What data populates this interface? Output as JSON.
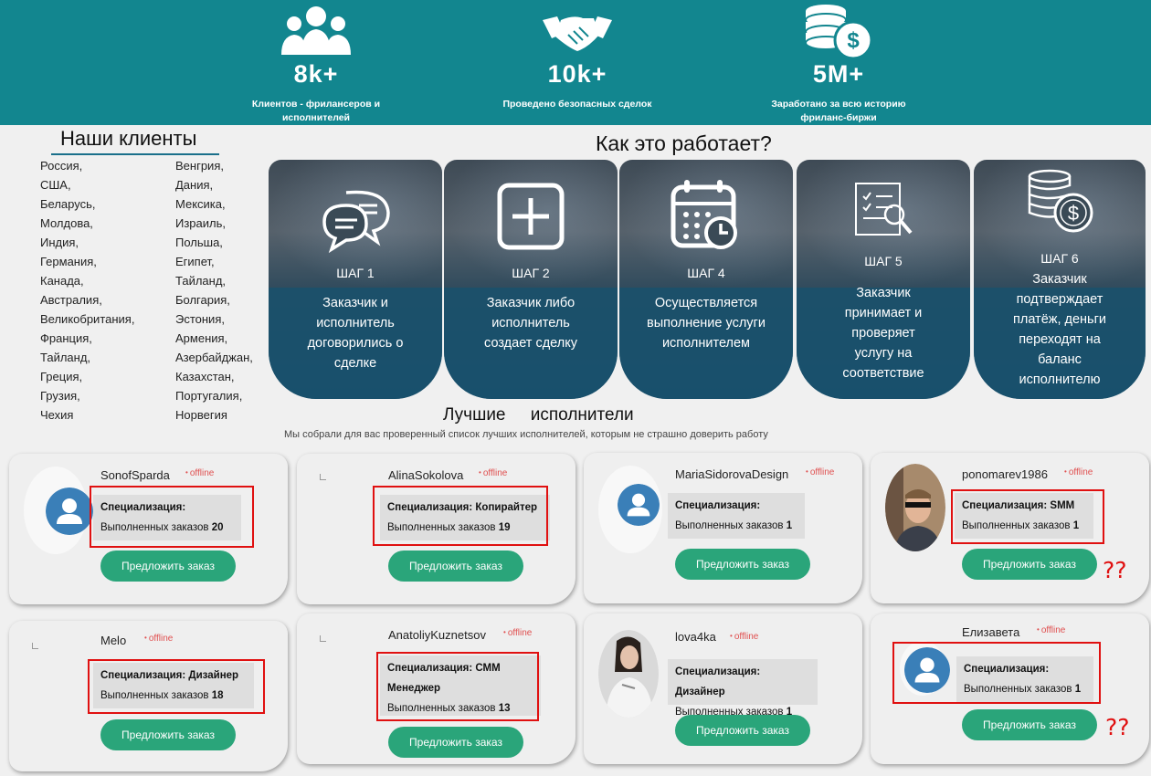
{
  "stats": [
    {
      "value": "8k+",
      "caption": "Клиентов - фрилансеров и исполнителей",
      "icon": "users-icon"
    },
    {
      "value": "10k+",
      "caption": "Проведено безопасных сделок",
      "icon": "handshake-icon"
    },
    {
      "value": "5M+",
      "caption": "Заработано за всю историю фриланс-биржи",
      "icon": "coins-dollar-icon"
    }
  ],
  "clients": {
    "title": "Наши клиенты",
    "col1": [
      "Россия,",
      "США,",
      "Беларусь,",
      "Молдова,",
      "Индия,",
      "Германия,",
      "Канада,",
      "Австралия,",
      "Великобритания,",
      "Франция,",
      "Тайланд,",
      "Греция,",
      "Грузия,",
      "Чехия"
    ],
    "col2": [
      "Венгрия,",
      "Дания,",
      "Мексика,",
      "Израиль,",
      "Польша,",
      "Египет,",
      "Тайланд,",
      "Болгария,",
      "Эстония,",
      "Армения,",
      "Азербайджан,",
      "Казахстан,",
      "Португалия,",
      "Норвегия"
    ]
  },
  "how": {
    "title": "Как это работает?",
    "steps": [
      {
        "label": "ШАГ 1",
        "text": "Заказчик и исполнитель договорились о сделке",
        "icon": "chat-bubbles-icon"
      },
      {
        "label": "ШАГ 2",
        "text": "Заказчик либо исполнитель создает сделку",
        "icon": "plus-square-icon"
      },
      {
        "label": "ШАГ 4",
        "text": "Осуществляется выполнение услуги исполнителем",
        "icon": "calendar-clock-icon"
      },
      {
        "label": "ШАГ 5",
        "text": "Заказчик принимает и проверяет услугу на соответствие",
        "icon": "document-check-icon"
      },
      {
        "label": "ШАГ 6",
        "text": "Заказчик подтверждает платёж, деньги переходят на баланс исполнителю",
        "icon": "coins-dollar-icon"
      }
    ]
  },
  "best": {
    "title": "Лучшие исполнители",
    "subtitle": "Мы собрали для вас проверенный список лучших исполнителей, которым не страшно доверить работу"
  },
  "common": {
    "offline": "offline",
    "spec": "Специализация:",
    "done": "Выполненных заказов",
    "button": "Предложить заказ",
    "qq": "??"
  },
  "cards": [
    {
      "name": "SonofSparda",
      "spec": "",
      "count": "20"
    },
    {
      "name": "AlinaSokolova",
      "spec": "Копирайтер",
      "count": "19"
    },
    {
      "name": "MariaSidorovaDesign",
      "spec": "",
      "count": "1"
    },
    {
      "name": "ponomarev1986",
      "spec": "SMM",
      "count": "1"
    },
    {
      "name": "Melo",
      "spec": "Дизайнер",
      "count": "18"
    },
    {
      "name": "AnatoliyKuznetsov",
      "spec": "СММ Менеджер",
      "count": "13"
    },
    {
      "name": "lova4ka",
      "spec": "Дизайнер",
      "count": "1"
    },
    {
      "name": "Елизавета",
      "spec": "",
      "count": "1"
    }
  ]
}
